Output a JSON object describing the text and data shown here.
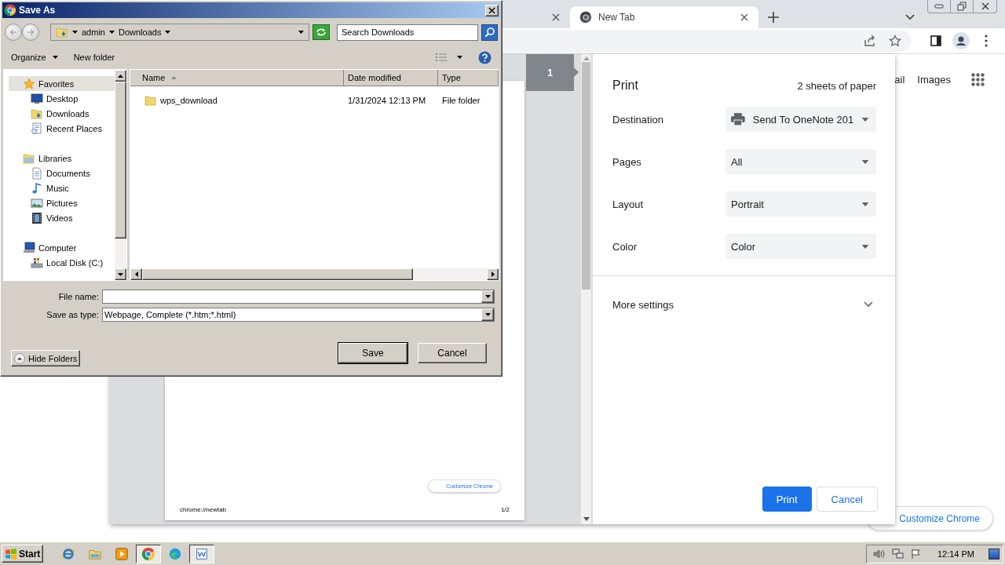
{
  "browser": {
    "tabs": [
      {
        "selected": false
      },
      {
        "label": "New Tab",
        "selected": true
      }
    ],
    "new_tab_page": {
      "links": [
        "ail",
        "Images"
      ],
      "customize_button": "Customize Chrome"
    },
    "print_preview": {
      "page_tag": "1",
      "preview_page": {
        "button": "Customize Chrome",
        "footer_url": "chrome://newtab",
        "footer_page": "1/2"
      },
      "title": "Print",
      "sheets": "2 sheets of paper",
      "settings": [
        {
          "label": "Destination",
          "value": "Send To OneNote 201",
          "kind": "printer"
        },
        {
          "label": "Pages",
          "value": "All",
          "kind": "select"
        },
        {
          "label": "Layout",
          "value": "Portrait",
          "kind": "select"
        },
        {
          "label": "Color",
          "value": "Color",
          "kind": "select"
        }
      ],
      "more_settings": {
        "label": "More settings",
        "expanded": false
      },
      "buttons": [
        {
          "label": "Print",
          "kind": "primary"
        },
        {
          "label": "Cancel",
          "kind": "secondary"
        }
      ]
    }
  },
  "save_dialog": {
    "title": "Save As",
    "breadcrumb": [
      "admin",
      "Downloads"
    ],
    "search": {
      "placeholder": "Search Downloads"
    },
    "toolbar": [
      "Organize",
      "New folder"
    ],
    "nav_tree": [
      {
        "label": "Favorites",
        "kind": "star",
        "selected": true,
        "children": [
          {
            "label": "Desktop",
            "kind": "desktop",
            "selected": false
          },
          {
            "label": "Downloads",
            "kind": "downloads",
            "selected": false
          },
          {
            "label": "Recent Places",
            "kind": "recent",
            "selected": false
          }
        ]
      },
      {
        "label": "Libraries",
        "kind": "library",
        "selected": false,
        "children": [
          {
            "label": "Documents",
            "kind": "documents",
            "selected": false
          },
          {
            "label": "Music",
            "kind": "music",
            "selected": false
          },
          {
            "label": "Pictures",
            "kind": "pictures",
            "selected": false
          },
          {
            "label": "Videos",
            "kind": "videos",
            "selected": false
          }
        ]
      },
      {
        "label": "Computer",
        "kind": "computer",
        "selected": false,
        "children": [
          {
            "label": "Local Disk (C:)",
            "kind": "disk",
            "selected": false
          }
        ]
      }
    ],
    "columns": [
      {
        "label": "Name",
        "sorted": true
      },
      {
        "label": "Date modified",
        "sorted": false
      },
      {
        "label": "Type",
        "sorted": false
      }
    ],
    "rows": [
      {
        "name": "wps_download",
        "date": "1/31/2024 12:13 PM",
        "type": "File folder"
      }
    ],
    "file_name": {
      "label": "File name:"
    },
    "save_type": {
      "label": "Save as type:",
      "value": "Webpage, Complete (*.htm;*.html)"
    },
    "hide_folders": "Hide Folders",
    "buttons": [
      {
        "label": "Save",
        "default": true
      },
      {
        "label": "Cancel",
        "default": false
      }
    ]
  },
  "taskbar": {
    "start": "Start",
    "apps": [
      {
        "kind": "ie",
        "active": false
      },
      {
        "kind": "explorer",
        "active": false
      },
      {
        "kind": "player",
        "active": false
      },
      {
        "kind": "chrome",
        "active": true
      },
      {
        "kind": "edge",
        "active": false
      },
      {
        "kind": "wps",
        "active": true
      }
    ],
    "clock": "12:14 PM"
  }
}
